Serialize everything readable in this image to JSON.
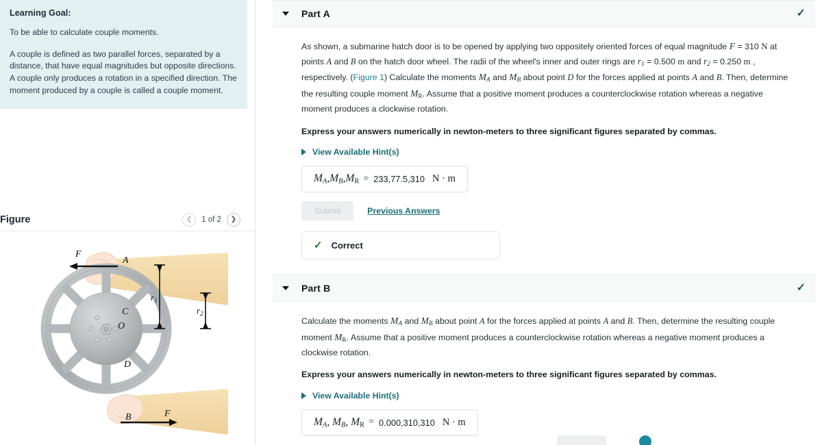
{
  "learning_goal": {
    "title": "Learning Goal:",
    "objective": "To be able to calculate couple moments.",
    "body": "A couple is defined as two parallel forces, separated by a distance, that have equal magnitudes but opposite directions. A couple only produces a rotation in a specified direction. The moment produced by a couple is called a couple moment."
  },
  "figure": {
    "title": "Figure",
    "counter": "1 of 2",
    "prev_icon": "chevron-left-icon",
    "next_icon": "chevron-right-icon",
    "labels": {
      "force_top": "F",
      "force_bottom": "F",
      "point_a": "A",
      "point_b": "B",
      "point_c": "C",
      "point_d": "D",
      "center_o": "O",
      "radius_1": "r",
      "radius_1_sub": "1",
      "radius_2": "r",
      "radius_2_sub": "2"
    }
  },
  "parts": [
    {
      "id": "part-a",
      "title": "Part A",
      "status_icon": "check-icon",
      "caret_icon": "caret-down-icon",
      "prose": {
        "s1": "As shown, a submarine hatch door is to be opened by applying two oppositely oriented forces of equal magnitude ",
        "F": "F",
        "s2": " = 310 ",
        "N": "N",
        "s3": " at points ",
        "A1": "A",
        "s4": " and ",
        "B1": "B",
        "s5": " on the hatch door wheel. The radii of the wheel's inner and outer rings are ",
        "r1": "r",
        "r1sub": "1",
        "s6": " = 0.500 ",
        "m1": "m",
        "s7": " and ",
        "r2": "r",
        "r2sub": "2",
        "s8": " = 0.250 ",
        "m2": "m",
        "s9": " , respectively. (",
        "figlink": "Figure 1",
        "s10": ") Calculate the moments ",
        "MA": "M",
        "MAsub": "A",
        "s11": " and ",
        "MB": "M",
        "MBsub": "B",
        "s12": " about point ",
        "D": "D",
        "s13": " for the forces applied at points ",
        "A2": "A",
        "s14": " and ",
        "B2": "B",
        "s15": ". Then, determine the resulting couple moment ",
        "MR": "M",
        "MRsub": "R",
        "s16": ". Assume that a positive moment produces a counterclockwise rotation whereas a negative moment produces a clockwise rotation."
      },
      "instruction": "Express your answers numerically in newton-meters to three significant figures separated by commas.",
      "hint_label": "View Available Hint(s)",
      "hint_icon": "triangle-right-icon",
      "answer": {
        "label_MA": "M",
        "label_MA_sub": "A",
        "label_MB": "M",
        "label_MB_sub": "B",
        "label_MR": "M",
        "label_MR_sub": "R",
        "equals": "=",
        "value": "233,77.5,310",
        "unit": "N · m"
      },
      "submit_label": "Submit",
      "previous_answers_label": "Previous Answers",
      "feedback": {
        "icon": "check-icon",
        "text": "Correct"
      }
    },
    {
      "id": "part-b",
      "title": "Part B",
      "status_icon": "check-icon",
      "caret_icon": "caret-down-icon",
      "prose": {
        "s1": "Calculate the moments ",
        "MA": "M",
        "MAsub": "A",
        "s2": " and ",
        "MB": "M",
        "MBsub": "B",
        "s3": " about point ",
        "A": "A",
        "s4": " for the forces applied at points ",
        "A2": "A",
        "s5": " and ",
        "B2": "B",
        "s6": ". Then, determine the resulting couple moment ",
        "MR": "M",
        "MRsub": "R",
        "s7": ". Assume that a positive moment produces a counterclockwise rotation whereas a negative moment produces a clockwise rotation."
      },
      "instruction": "Express your answers numerically in newton-meters to three significant figures separated by commas.",
      "hint_label": "View Available Hint(s)",
      "hint_icon": "triangle-right-icon",
      "answer": {
        "label_MA": "M",
        "label_MA_sub": "A",
        "label_MB": "M",
        "label_MB_sub": "B",
        "label_MR": "M",
        "label_MR_sub": "R",
        "equals": "=",
        "value": "0.000,310,310",
        "unit": "N · m"
      }
    }
  ],
  "colors": {
    "goal_panel_bg": "#e3f0f2",
    "link_teal": "#1b6e78",
    "correct_green": "#1e7a28",
    "header_bg": "#f7f8f8",
    "sleeve": "#f2d9a4",
    "skin": "#fbe3d2",
    "wheel_gray": "#b3b6b8"
  }
}
